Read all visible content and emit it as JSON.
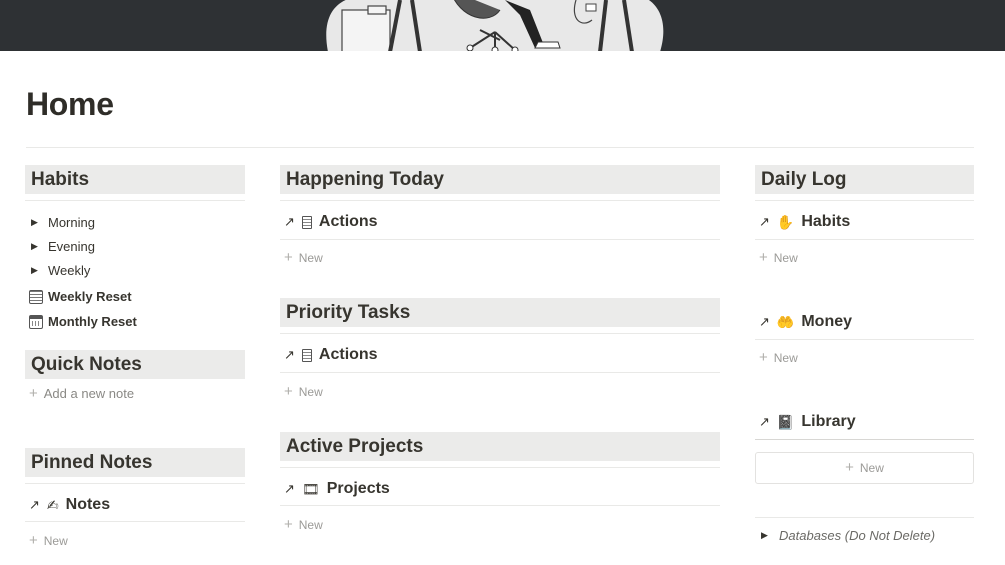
{
  "page": {
    "title": "Home"
  },
  "left": {
    "habits_header": "Habits",
    "toggles": [
      {
        "label": "Morning"
      },
      {
        "label": "Evening"
      },
      {
        "label": "Weekly"
      }
    ],
    "links": [
      {
        "label": "Weekly Reset",
        "icon": "calendar-grid-icon"
      },
      {
        "label": "Monthly Reset",
        "icon": "calendar-icon"
      }
    ],
    "quick_notes_header": "Quick Notes",
    "add_note": "Add a new note",
    "pinned_header": "Pinned Notes",
    "pinned_db": {
      "title": "Notes",
      "icon": "hand-note-icon"
    },
    "pinned_new": "New"
  },
  "middle": {
    "sections": [
      {
        "header": "Happening Today",
        "db_title": "Actions",
        "icon": "clipboard-icon",
        "new": "New"
      },
      {
        "header": "Priority Tasks",
        "db_title": "Actions",
        "icon": "clipboard-icon",
        "new": "New"
      },
      {
        "header": "Active Projects",
        "db_title": "Projects",
        "icon": "film-icon",
        "new": "New"
      }
    ]
  },
  "right": {
    "header": "Daily Log",
    "dbs": [
      {
        "title": "Habits",
        "icon": "hand-icon",
        "new": "New"
      },
      {
        "title": "Money",
        "icon": "hand-coin-icon",
        "new": "New"
      },
      {
        "title": "Library",
        "icon": "book-icon",
        "new": "New"
      }
    ],
    "databases_toggle": "Databases (Do Not Delete)"
  }
}
